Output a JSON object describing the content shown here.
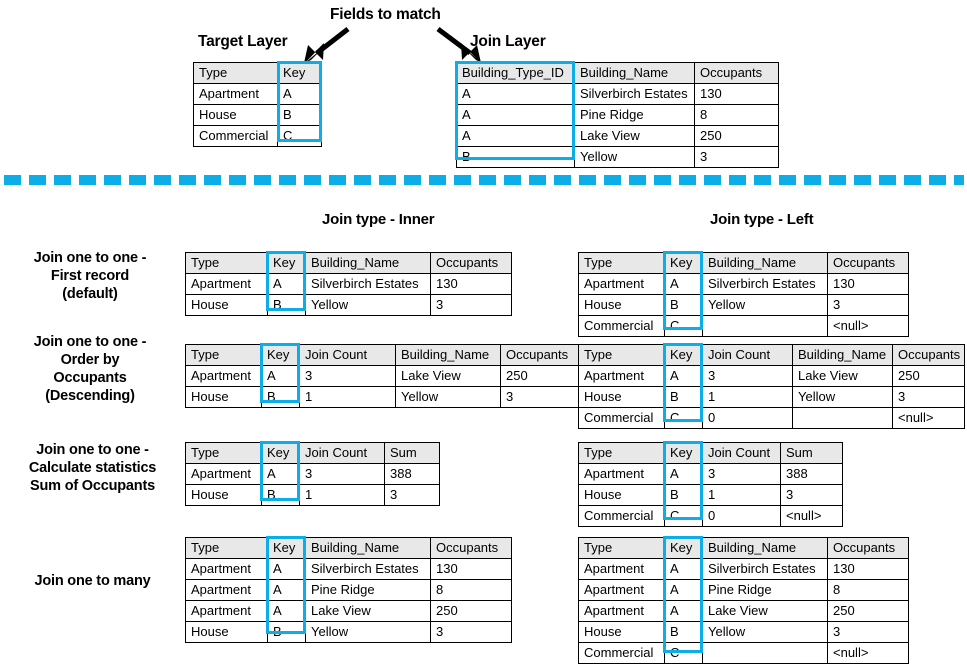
{
  "title_top": {
    "fields_to_match": "Fields to match",
    "target_layer": "Target Layer",
    "join_layer": "Join Layer"
  },
  "section_titles": {
    "inner": "Join type - Inner",
    "left": "Join type - Left"
  },
  "row_labels": {
    "first_record": "Join one to one -\nFirst record\n(default)",
    "order_by": "Join one to one -\nOrder by\nOccupants\n(Descending)",
    "calc_stats": "Join one to one -\nCalculate statistics\nSum of Occupants",
    "one_to_many": "Join one to many"
  },
  "colors": {
    "highlight": "#0DAEE8",
    "header_fill": "#E8E8E8",
    "border": "#000000",
    "text": "#000000"
  },
  "icons": {
    "arrow_left": "arrow-down-left-icon",
    "arrow_right": "arrow-down-right-icon",
    "divider": "dashed-divider-icon"
  },
  "tables": {
    "target_layer": {
      "headers": [
        "Type",
        "Key"
      ],
      "rows": [
        [
          "Apartment",
          "A"
        ],
        [
          "House",
          "B"
        ],
        [
          "Commercial",
          "C"
        ]
      ],
      "highlight_column": 1
    },
    "join_layer": {
      "headers": [
        "Building_Type_ID",
        "Building_Name",
        "Occupants"
      ],
      "rows": [
        [
          "A",
          "Silverbirch Estates",
          "130"
        ],
        [
          "A",
          "Pine Ridge",
          "8"
        ],
        [
          "A",
          "Lake View",
          "250"
        ],
        [
          "B",
          "Yellow",
          "3"
        ]
      ],
      "highlight_column": 0
    },
    "inner_first_record": {
      "headers": [
        "Type",
        "Key",
        "Building_Name",
        "Occupants"
      ],
      "rows": [
        [
          "Apartment",
          "A",
          "Silverbirch Estates",
          "130"
        ],
        [
          "House",
          "B",
          "Yellow",
          "3"
        ]
      ],
      "highlight_column": 1
    },
    "left_first_record": {
      "headers": [
        "Type",
        "Key",
        "Building_Name",
        "Occupants"
      ],
      "rows": [
        [
          "Apartment",
          "A",
          "Silverbirch Estates",
          "130"
        ],
        [
          "House",
          "B",
          "Yellow",
          "3"
        ],
        [
          "Commercial",
          "C",
          "",
          "<null>"
        ]
      ],
      "highlight_column": 1
    },
    "inner_order_by": {
      "headers": [
        "Type",
        "Key",
        "Join Count",
        "Building_Name",
        "Occupants"
      ],
      "rows": [
        [
          "Apartment",
          "A",
          "3",
          "Lake View",
          "250"
        ],
        [
          "House",
          "B",
          "1",
          "Yellow",
          "3"
        ]
      ],
      "highlight_column": 1
    },
    "left_order_by": {
      "headers": [
        "Type",
        "Key",
        "Join Count",
        "Building_Name",
        "Occupants"
      ],
      "rows": [
        [
          "Apartment",
          "A",
          "3",
          "Lake View",
          "250"
        ],
        [
          "House",
          "B",
          "1",
          "Yellow",
          "3"
        ],
        [
          "Commercial",
          "C",
          "0",
          "",
          "<null>"
        ]
      ],
      "highlight_column": 1
    },
    "inner_calc_stats": {
      "headers": [
        "Type",
        "Key",
        "Join Count",
        "Sum"
      ],
      "rows": [
        [
          "Apartment",
          "A",
          "3",
          "388"
        ],
        [
          "House",
          "B",
          "1",
          "3"
        ]
      ],
      "highlight_column": 1
    },
    "left_calc_stats": {
      "headers": [
        "Type",
        "Key",
        "Join Count",
        "Sum"
      ],
      "rows": [
        [
          "Apartment",
          "A",
          "3",
          "388"
        ],
        [
          "House",
          "B",
          "1",
          "3"
        ],
        [
          "Commercial",
          "C",
          "0",
          "<null>"
        ]
      ],
      "highlight_column": 1
    },
    "inner_one_to_many": {
      "headers": [
        "Type",
        "Key",
        "Building_Name",
        "Occupants"
      ],
      "rows": [
        [
          "Apartment",
          "A",
          "Silverbirch Estates",
          "130"
        ],
        [
          "Apartment",
          "A",
          "Pine Ridge",
          "8"
        ],
        [
          "Apartment",
          "A",
          "Lake View",
          "250"
        ],
        [
          "House",
          "B",
          "Yellow",
          "3"
        ]
      ],
      "highlight_column": 1
    },
    "left_one_to_many": {
      "headers": [
        "Type",
        "Key",
        "Building_Name",
        "Occupants"
      ],
      "rows": [
        [
          "Apartment",
          "A",
          "Silverbirch Estates",
          "130"
        ],
        [
          "Apartment",
          "A",
          "Pine Ridge",
          "8"
        ],
        [
          "Apartment",
          "A",
          "Lake View",
          "250"
        ],
        [
          "House",
          "B",
          "Yellow",
          "3"
        ],
        [
          "Commercial",
          "C",
          "",
          "<null>"
        ]
      ],
      "highlight_column": 1
    }
  }
}
